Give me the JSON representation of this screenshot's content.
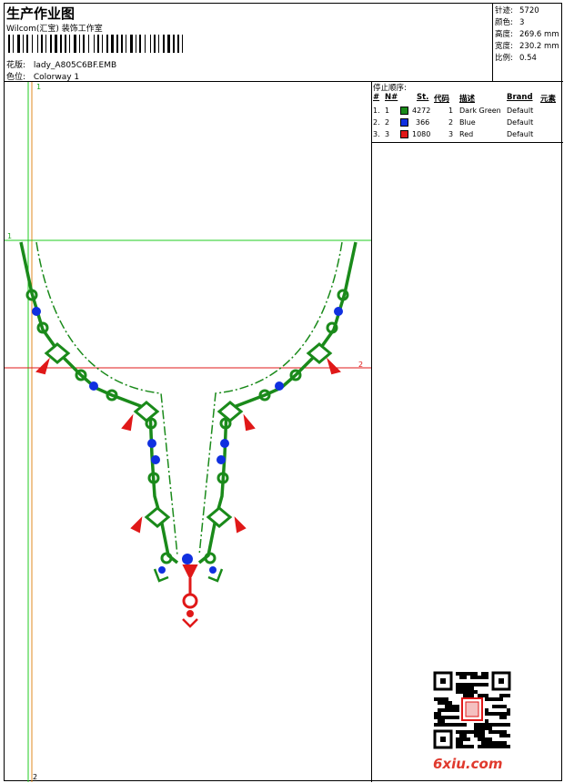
{
  "header": {
    "title": "生产作业图",
    "company": "Wilcom(汇宝) 装饰工作室",
    "design_label": "花版:",
    "design_value": "lady_A805C6BF.EMB",
    "color_label": "色位:",
    "color_value": "Colorway 1"
  },
  "stats": [
    {
      "label": "针迹:",
      "value": "5720"
    },
    {
      "label": "颜色:",
      "value": "3"
    },
    {
      "label": "高度:",
      "value": "269.6 mm"
    },
    {
      "label": "宽度:",
      "value": "230.2 mm"
    },
    {
      "label": "比例:",
      "value": "0.54"
    }
  ],
  "stop_sequence": {
    "title": "停止顺序:",
    "headers": {
      "no": "#",
      "needle": "N#",
      "stitches": "St.",
      "code": "代码",
      "description": "描述",
      "brand": "Brand",
      "element": "元素"
    },
    "rows": [
      {
        "no": "1.",
        "needle": "1",
        "color": "#1a8a1a",
        "stitches": "4272",
        "code": "1",
        "description": "Dark Green",
        "brand": "Default"
      },
      {
        "no": "2.",
        "needle": "2",
        "color": "#1030e0",
        "stitches": "366",
        "code": "2",
        "description": "Blue",
        "brand": "Default"
      },
      {
        "no": "3.",
        "needle": "3",
        "color": "#e01818",
        "stitches": "1080",
        "code": "3",
        "description": "Red",
        "brand": "Default"
      }
    ]
  },
  "guides": {
    "v1": "1",
    "v2": "2",
    "h1": "1",
    "h2": "2"
  },
  "watermark": {
    "site": "6xiu.com"
  },
  "colors": {
    "green": "#1a8a1a",
    "blue": "#1030e0",
    "red": "#e01818",
    "guide_green": "#22cc22",
    "guide_red": "#e01818",
    "guide_orange": "#e08a20"
  }
}
